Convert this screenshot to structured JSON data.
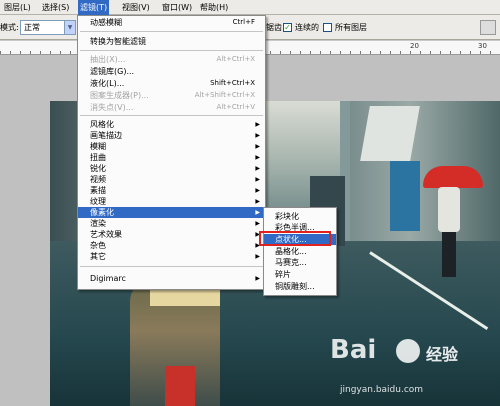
{
  "menubar": {
    "items": [
      {
        "label": "图层(L)"
      },
      {
        "label": "选择(S)"
      },
      {
        "label": "滤镜(T)"
      },
      {
        "label": "视图(V)"
      },
      {
        "label": "窗口(W)"
      },
      {
        "label": "帮助(H)"
      }
    ]
  },
  "options": {
    "mode_label": "模式:",
    "mode_value": "正常",
    "antialias_label": "锯齿",
    "contiguous_label": "连续的",
    "all_layers_label": "所有图层"
  },
  "ruler": {
    "numbers": [
      "20",
      "30"
    ]
  },
  "filter_menu": {
    "last_filter": {
      "label": "动感模糊",
      "shortcut": "Ctrl+F"
    },
    "smart_filter": {
      "label": "转换为智能滤镜"
    },
    "extract": {
      "label": "抽出(X)...",
      "shortcut": "Alt+Ctrl+X"
    },
    "gallery": {
      "label": "滤镜库(G)..."
    },
    "liquify": {
      "label": "液化(L)...",
      "shortcut": "Shift+Ctrl+X"
    },
    "pattern_maker": {
      "label": "图案生成器(P)...",
      "shortcut": "Alt+Shift+Ctrl+X"
    },
    "vanishing_point": {
      "label": "消失点(V)...",
      "shortcut": "Alt+Ctrl+V"
    },
    "categories": [
      "风格化",
      "画笔描边",
      "模糊",
      "扭曲",
      "锐化",
      "视频",
      "素描",
      "纹理",
      "像素化",
      "渲染",
      "艺术效果",
      "杂色",
      "其它"
    ],
    "digimarc": "Digimarc"
  },
  "pixelate_submenu": {
    "items": [
      "彩块化",
      "彩色半调...",
      "点状化...",
      "晶格化...",
      "马赛克...",
      "碎片",
      "铜版雕刻..."
    ]
  },
  "watermark": {
    "logo_text": "Bai",
    "brand": "经验",
    "url": "jingyan.baidu.com"
  }
}
